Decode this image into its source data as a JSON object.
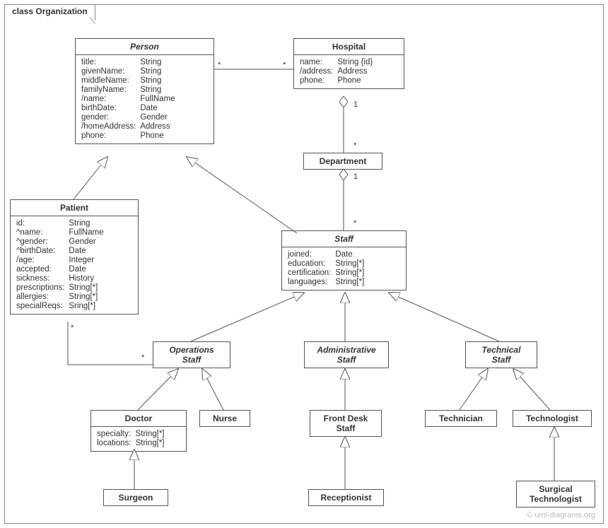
{
  "frame_title": "class Organization",
  "watermark": "© uml-diagrams.org",
  "classes": {
    "person": {
      "title": "Person",
      "attrs": [
        [
          "title:",
          "String"
        ],
        [
          "givenName:",
          "String"
        ],
        [
          "middleName:",
          "String"
        ],
        [
          "familyName:",
          "String"
        ],
        [
          "/name:",
          "FullName"
        ],
        [
          "birthDate:",
          "Date"
        ],
        [
          "gender:",
          "Gender"
        ],
        [
          "/homeAddress:",
          "Address"
        ],
        [
          "phone:",
          "Phone"
        ]
      ]
    },
    "hospital": {
      "title": "Hospital",
      "attrs": [
        [
          "name:",
          "String {id}"
        ],
        [
          "/address:",
          "Address"
        ],
        [
          "phone:",
          "Phone"
        ]
      ]
    },
    "department": {
      "title": "Department",
      "attrs": []
    },
    "patient": {
      "title": "Patient",
      "attrs": [
        [
          "id:",
          "String"
        ],
        [
          "^name:",
          "FullName"
        ],
        [
          "^gender:",
          "Gender"
        ],
        [
          "^birthDate:",
          "Date"
        ],
        [
          "/age:",
          "Integer"
        ],
        [
          "accepted:",
          "Date"
        ],
        [
          "sickness:",
          "History"
        ],
        [
          "prescriptions:",
          "String[*]"
        ],
        [
          "allergies:",
          "String[*]"
        ],
        [
          "specialReqs:",
          "Sring[*]"
        ]
      ]
    },
    "staff": {
      "title": "Staff",
      "attrs": [
        [
          "joined:",
          "Date"
        ],
        [
          "education:",
          "String[*]"
        ],
        [
          "certification:",
          "String[*]"
        ],
        [
          "languages:",
          "String[*]"
        ]
      ]
    },
    "operations_staff": {
      "title": "Operations\nStaff",
      "attrs": []
    },
    "administrative_staff": {
      "title": "Administrative\nStaff",
      "attrs": []
    },
    "technical_staff": {
      "title": "Technical\nStaff",
      "attrs": []
    },
    "doctor": {
      "title": "Doctor",
      "attrs": [
        [
          "specialty:",
          "String[*]"
        ],
        [
          "locations:",
          "String[*]"
        ]
      ]
    },
    "nurse": {
      "title": "Nurse",
      "attrs": []
    },
    "front_desk_staff": {
      "title": "Front Desk\nStaff",
      "attrs": []
    },
    "receptionist": {
      "title": "Receptionist",
      "attrs": []
    },
    "technician": {
      "title": "Technician",
      "attrs": []
    },
    "technologist": {
      "title": "Technologist",
      "attrs": []
    },
    "surgical_technologist": {
      "title": "Surgical\nTechnologist",
      "attrs": []
    },
    "surgeon": {
      "title": "Surgeon",
      "attrs": []
    }
  },
  "multiplicities": {
    "person_hosp_l": "*",
    "person_hosp_r": "*",
    "hosp_dept_top": "1",
    "hosp_dept_bottom": "*",
    "dept_staff_top": "1",
    "dept_staff_bottom": "*",
    "patient_ops_l": "*",
    "patient_ops_r": "*"
  }
}
